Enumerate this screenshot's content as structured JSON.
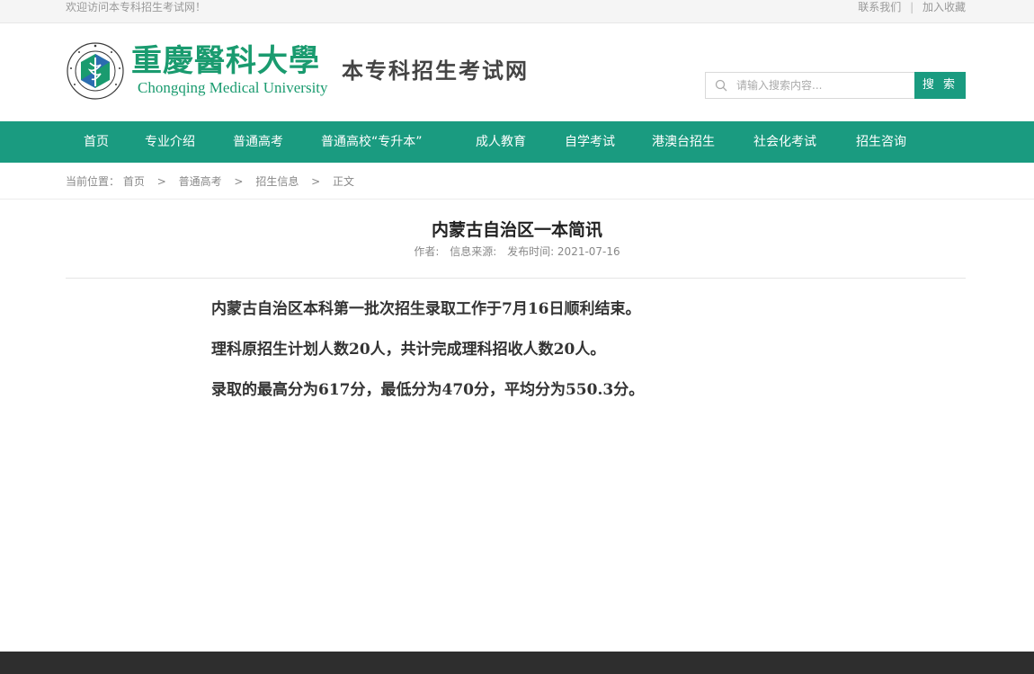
{
  "topbar": {
    "welcome": "欢迎访问本专科招生考试网！",
    "contact": "联系我们",
    "separator": "|",
    "bookmark": "加入收藏"
  },
  "header": {
    "university_cn": "重慶醫科大學",
    "university_en": "Chongqing Medical University",
    "site_name": "本专科招生考试网",
    "emblem_icon": "university-emblem-icon"
  },
  "search": {
    "placeholder": "请输入搜索内容...",
    "button": "搜 索",
    "icon": "search-icon"
  },
  "nav": {
    "items": [
      {
        "label": "首页"
      },
      {
        "label": "专业介绍"
      },
      {
        "label": "普通高考"
      },
      {
        "label": "普通高校“专升本”"
      },
      {
        "label": "成人教育"
      },
      {
        "label": "自学考试"
      },
      {
        "label": "港澳台招生"
      },
      {
        "label": "社会化考试"
      },
      {
        "label": "招生咨询"
      }
    ]
  },
  "breadcrumb": {
    "prefix": "当前位置：",
    "items": [
      "首页",
      "普通高考",
      "招生信息",
      "正文"
    ],
    "arrow": ">"
  },
  "article": {
    "title": "内蒙古自治区一本简讯",
    "author_label": "作者:",
    "source_label": "信息来源:",
    "date_label": "发布时间: 2021-07-16",
    "paragraphs": [
      "内蒙古自治区本科第一批次招生录取工作于7月16日顺利结束。",
      "理科原招生计划人数20人，共计完成理科招收人数20人。",
      "录取的最高分为617分，最低分为470分，平均分为550.3分。"
    ]
  },
  "colors": {
    "brand_green": "#1a9b80",
    "logo_green": "#1a9b6f",
    "footer_bg": "#2e2e2e"
  }
}
